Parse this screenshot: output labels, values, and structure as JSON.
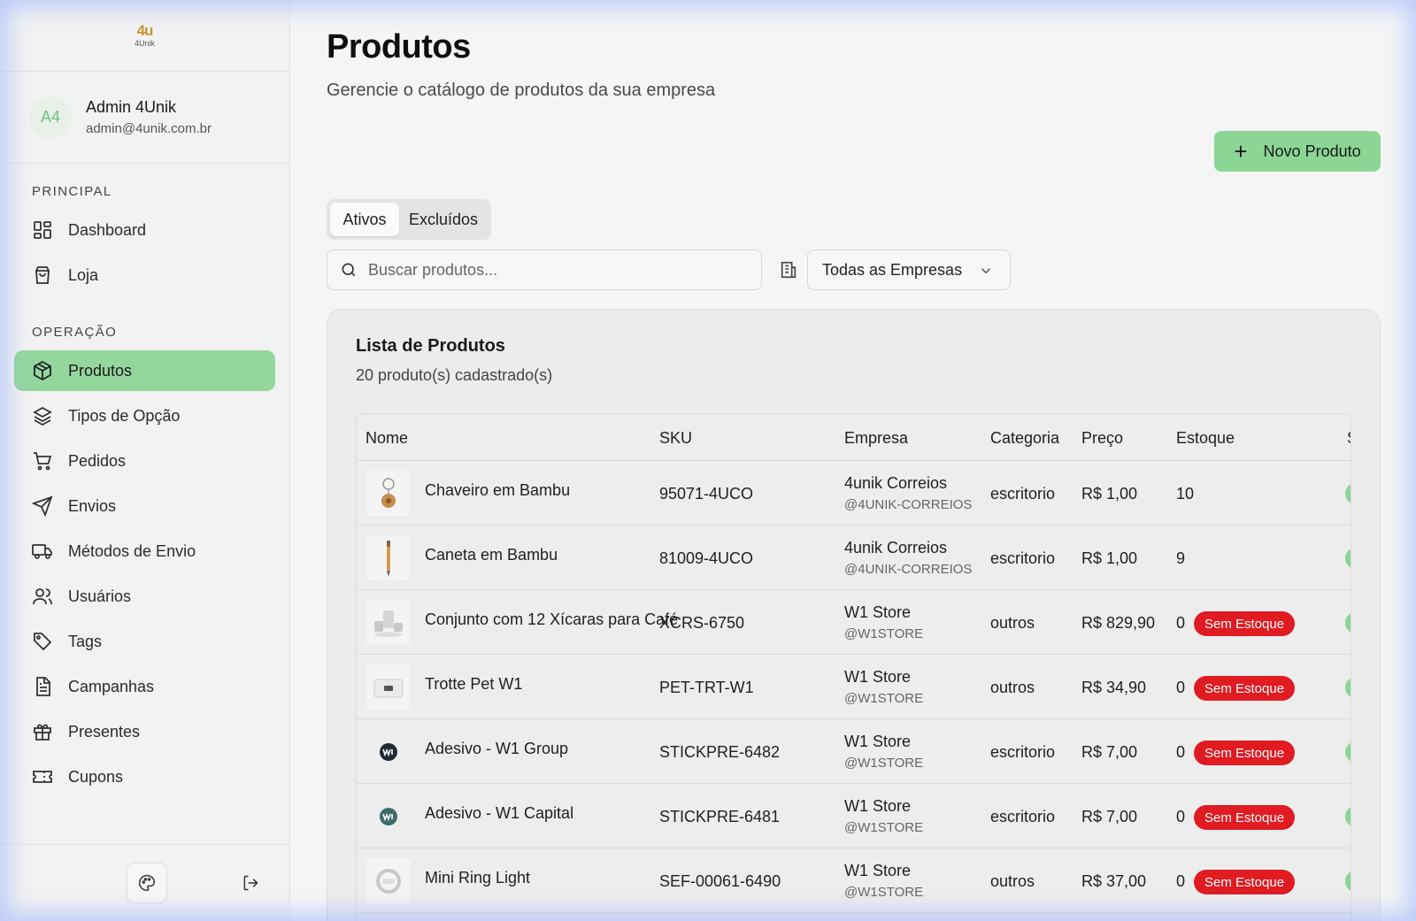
{
  "brand": {
    "logo_mark": "4u",
    "logo_text": "4Unik"
  },
  "user": {
    "initials": "A4",
    "name": "Admin 4Unik",
    "email": "admin@4unik.com.br"
  },
  "sidebar": {
    "section_principal": "PRINCIPAL",
    "section_operacao": "OPERAÇÃO",
    "items": [
      {
        "label": "Dashboard",
        "icon": "dashboard-icon"
      },
      {
        "label": "Loja",
        "icon": "shopping-bag-icon"
      },
      {
        "label": "Produtos",
        "icon": "box-icon",
        "active": true
      },
      {
        "label": "Tipos de Opção",
        "icon": "layers-icon"
      },
      {
        "label": "Pedidos",
        "icon": "cart-icon"
      },
      {
        "label": "Envios",
        "icon": "send-icon"
      },
      {
        "label": "Métodos de Envio",
        "icon": "truck-icon"
      },
      {
        "label": "Usuários",
        "icon": "users-icon"
      },
      {
        "label": "Tags",
        "icon": "tag-icon"
      },
      {
        "label": "Campanhas",
        "icon": "document-icon"
      },
      {
        "label": "Presentes",
        "icon": "gift-icon"
      },
      {
        "label": "Cupons",
        "icon": "ticket-icon"
      }
    ]
  },
  "header": {
    "title": "Produtos",
    "subtitle": "Gerencie o catálogo de produtos da sua empresa",
    "new_button": "Novo Produto"
  },
  "tabs": [
    {
      "label": "Ativos",
      "active": true
    },
    {
      "label": "Excluídos",
      "active": false
    }
  ],
  "search": {
    "placeholder": "Buscar produtos...",
    "value": ""
  },
  "company_filter": {
    "selected": "Todas as Empresas"
  },
  "list": {
    "title": "Lista de Produtos",
    "count_text": "20 produto(s) cadastrado(s)",
    "columns": [
      "Nome",
      "SKU",
      "Empresa",
      "Categoria",
      "Preço",
      "Estoque",
      "S"
    ],
    "rows": [
      {
        "name": "Chaveiro em Bambu",
        "sku": "95071-4UCO",
        "company": "4unik Correios",
        "handle": "@4UNIK-CORREIOS",
        "category": "escritorio",
        "price": "R$ 1,00",
        "stock": "10",
        "badge": ""
      },
      {
        "name": "Caneta em Bambu",
        "sku": "81009-4UCO",
        "company": "4unik Correios",
        "handle": "@4UNIK-CORREIOS",
        "category": "escritorio",
        "price": "R$ 1,00",
        "stock": "9",
        "badge": ""
      },
      {
        "name": "Conjunto com 12 Xícaras para Café",
        "sku": "XCRS-6750",
        "company": "W1 Store",
        "handle": "@W1STORE",
        "category": "outros",
        "price": "R$ 829,90",
        "stock": "0",
        "badge": "Sem Estoque"
      },
      {
        "name": "Trotte Pet W1",
        "sku": "PET-TRT-W1",
        "company": "W1 Store",
        "handle": "@W1STORE",
        "category": "outros",
        "price": "R$ 34,90",
        "stock": "0",
        "badge": "Sem Estoque"
      },
      {
        "name": "Adesivo - W1 Group",
        "sku": "STICKPRE-6482",
        "company": "W1 Store",
        "handle": "@W1STORE",
        "category": "escritorio",
        "price": "R$ 7,00",
        "stock": "0",
        "badge": "Sem Estoque"
      },
      {
        "name": "Adesivo - W1 Capital",
        "sku": "STICKPRE-6481",
        "company": "W1 Store",
        "handle": "@W1STORE",
        "category": "escritorio",
        "price": "R$ 7,00",
        "stock": "0",
        "badge": "Sem Estoque"
      },
      {
        "name": "Mini Ring Light",
        "sku": "SEF-00061-6490",
        "company": "W1 Store",
        "handle": "@W1STORE",
        "category": "outros",
        "price": "R$ 37,00",
        "stock": "0",
        "badge": "Sem Estoque"
      }
    ]
  },
  "colors": {
    "accent": "#8bd595",
    "danger": "#e01b22",
    "logo": "#c9962f"
  }
}
